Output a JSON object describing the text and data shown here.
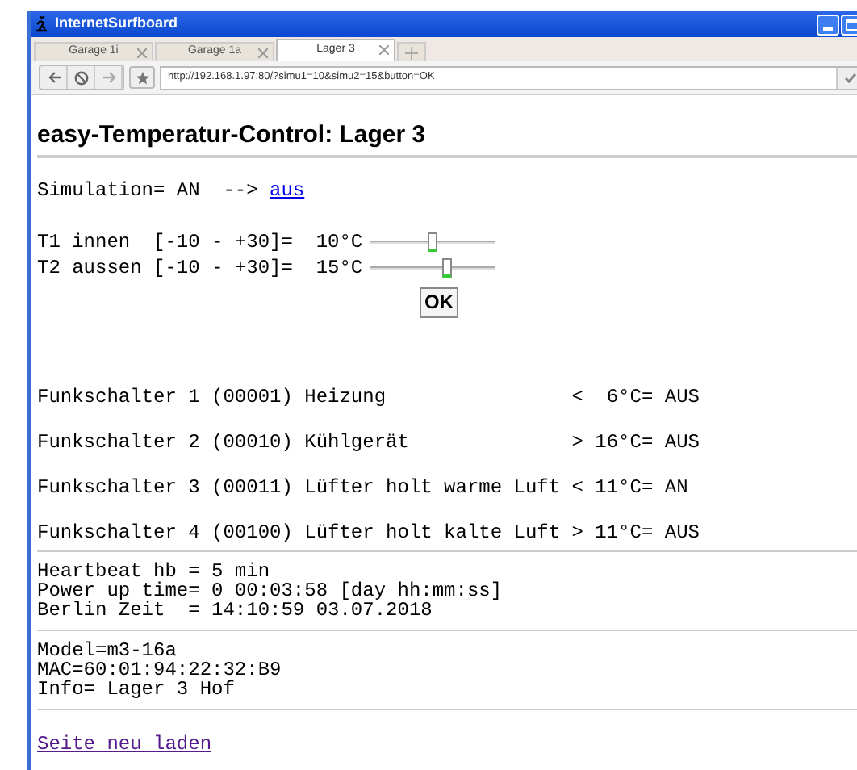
{
  "window": {
    "title": "InternetSurfboard"
  },
  "tabs": [
    {
      "label": "Garage 1i",
      "selected": false
    },
    {
      "label": "Garage 1a",
      "selected": false
    },
    {
      "label": "Lager 3",
      "selected": true
    }
  ],
  "address_bar": {
    "url": "http://192.168.1.97:80/?simu1=10&simu2=15&button=OK"
  },
  "heading": "easy-Temperatur-Control: Lager 3",
  "simulation": {
    "label": "Simulation= AN  --> ",
    "link": "aus"
  },
  "sliders": [
    {
      "label": "T1 innen  [-10 - +30]=  10°C",
      "level": 0.5
    },
    {
      "label": "T2 aussen [-10 - +30]=  15°C",
      "level": 0.625
    }
  ],
  "ok_button": "OK",
  "switches": [
    "Funkschalter 1 (00001) Heizung                <  6°C= AUS",
    "Funkschalter 2 (00010) Kühlgerät              > 16°C= AUS",
    "Funkschalter 3 (00011) Lüfter holt warme Luft < 11°C= AN",
    "Funkschalter 4 (00100) Lüfter holt kalte Luft > 11°C= AUS"
  ],
  "status_lines": [
    "Heartbeat hb = 5 min",
    "Power up time= 0 00:03:58 [day hh:mm:ss]",
    "Berlin Zeit  = 14:10:59 03.07.2018"
  ],
  "device_lines": [
    "Model=m3-16a",
    "MAC=60:01:94:22:32:B9",
    "Info= Lager 3 Hof"
  ],
  "reload_link": "Seite neu laden"
}
